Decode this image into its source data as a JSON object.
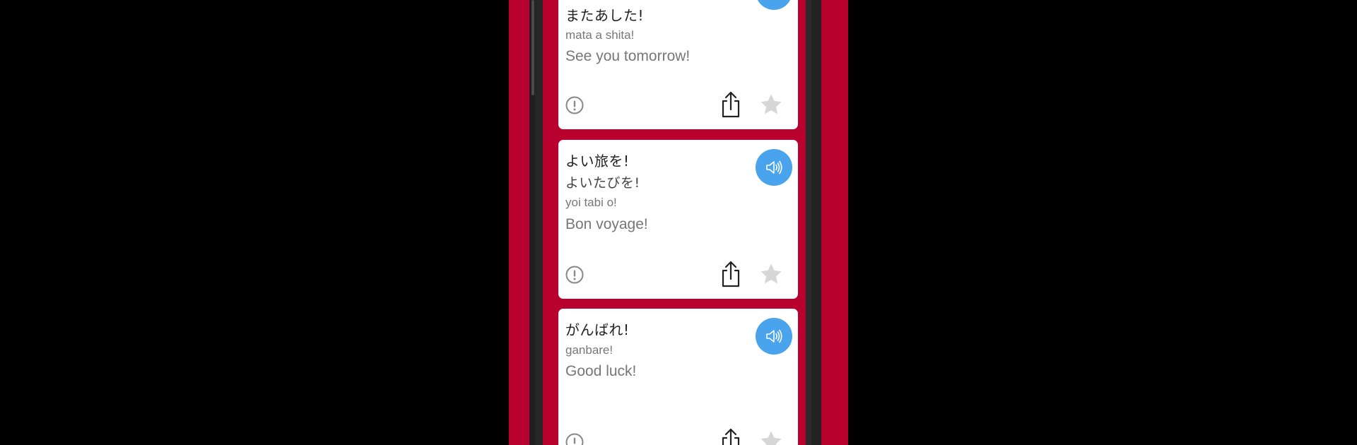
{
  "colors": {
    "background": "#b8012e",
    "card": "#ffffff",
    "speaker": "#4aa3ed",
    "star": "#d6d6d6"
  },
  "phrases": [
    {
      "japanese": "またあした!",
      "reading": "",
      "romaji": "mata a shita!",
      "english": "See you tomorrow!"
    },
    {
      "japanese": "よい旅を!",
      "reading": "よいたびを!",
      "romaji": "yoi tabi o!",
      "english": "Bon voyage!"
    },
    {
      "japanese": "がんばれ!",
      "reading": "",
      "romaji": "ganbare!",
      "english": "Good luck!"
    }
  ],
  "icons": {
    "speaker": "speaker-icon",
    "report": "exclamation-circle-icon",
    "share": "share-icon",
    "favorite": "star-icon"
  }
}
